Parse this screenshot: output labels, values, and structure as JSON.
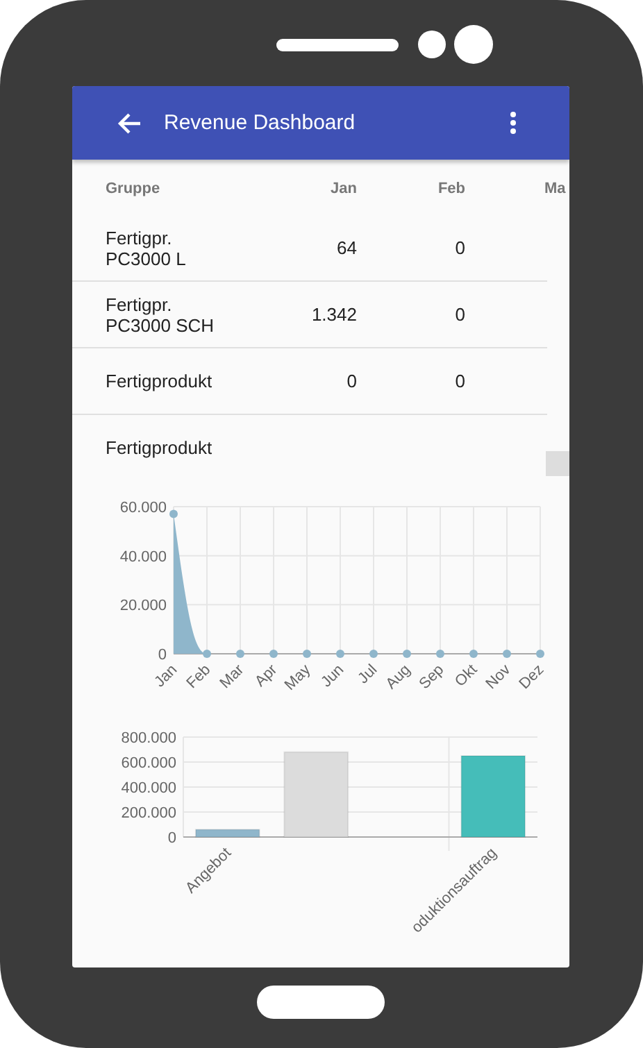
{
  "app_bar": {
    "title": "Revenue Dashboard"
  },
  "table": {
    "columns": [
      "Gruppe",
      "Jan",
      "Feb",
      "Ma"
    ],
    "rows": [
      {
        "cells": [
          "Fertigpr. PC3000 L",
          "64",
          "0"
        ]
      },
      {
        "cells": [
          "Fertigpr. PC3000 SCH",
          "1.342",
          "0"
        ]
      },
      {
        "cells": [
          "Fertigprodukt",
          "0",
          "0"
        ]
      },
      {
        "cells": [
          "Fertigprodukt"
        ]
      }
    ]
  },
  "line_chart": {
    "chart_data": {
      "type": "area",
      "categories": [
        "Jan",
        "Feb",
        "Mar",
        "Apr",
        "May",
        "Jun",
        "Jul",
        "Aug",
        "Sep",
        "Okt",
        "Nov",
        "Dez"
      ],
      "series": [
        {
          "color": "#8fb6cb",
          "values": [
            57000,
            0,
            0,
            0,
            0,
            0,
            0,
            0,
            0,
            0,
            0,
            0
          ]
        }
      ],
      "grid": true,
      "ylim": [
        0,
        60000
      ],
      "yticks": [
        {
          "value": 0,
          "label": "0"
        },
        {
          "value": 20000,
          "label": "20.000"
        },
        {
          "value": 40000,
          "label": "40.000"
        },
        {
          "value": 60000,
          "label": "60.000"
        }
      ]
    }
  },
  "bar_chart": {
    "chart_data": {
      "type": "bar",
      "categories": [
        "Angebot",
        null,
        null,
        "oduktionsauftrag"
      ],
      "series": [
        {
          "color": "#8fb6cb",
          "values": [
            60000,
            null,
            null,
            null
          ]
        },
        {
          "color": "#dcdcdc",
          "values": [
            null,
            680000,
            null,
            null
          ]
        },
        {
          "color": "#45bdb9",
          "values": [
            null,
            null,
            null,
            650000
          ]
        }
      ],
      "grid": true,
      "ylim": [
        0,
        800000
      ],
      "yticks": [
        {
          "value": 0,
          "label": "0"
        },
        {
          "value": 200000,
          "label": "200.000"
        },
        {
          "value": 400000,
          "label": "400.000"
        },
        {
          "value": 600000,
          "label": "600.000"
        },
        {
          "value": 800000,
          "label": "800.000"
        }
      ]
    }
  }
}
